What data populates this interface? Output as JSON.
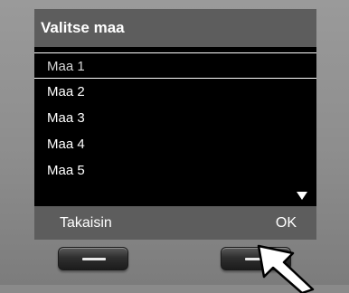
{
  "screen": {
    "title": "Valitse maa",
    "items": [
      {
        "label": "Maa 1",
        "selected": true
      },
      {
        "label": "Maa 2",
        "selected": false
      },
      {
        "label": "Maa 3",
        "selected": false
      },
      {
        "label": "Maa 4",
        "selected": false
      },
      {
        "label": "Maa 5",
        "selected": false
      }
    ],
    "scroll_indicator": "down-arrow-icon"
  },
  "softkeys": {
    "left_label": "Takaisin",
    "right_label": "OK"
  },
  "colors": {
    "screen_background": "#000000",
    "bar_background": "#5d5d5d",
    "text": "#ffffff",
    "device_body": "#8d8d8d"
  }
}
